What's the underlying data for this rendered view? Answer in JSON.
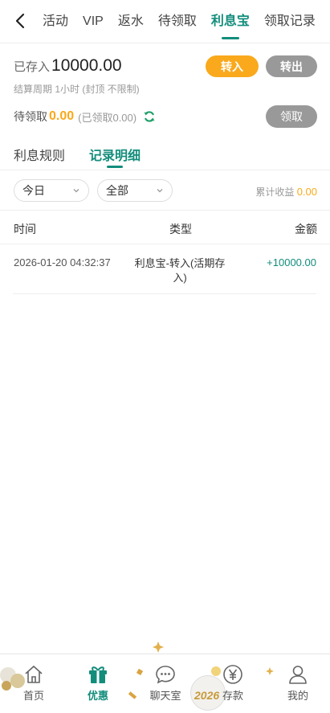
{
  "nav": {
    "tabs": [
      {
        "label": "活动"
      },
      {
        "label": "VIP"
      },
      {
        "label": "返水"
      },
      {
        "label": "待领取"
      },
      {
        "label": "利息宝"
      },
      {
        "label": "领取记录"
      }
    ],
    "active_tab": "利息宝"
  },
  "summary": {
    "deposited_label": "已存入",
    "deposited_value": "10000.00",
    "cycle_text": "结算周期 1小时 (封顶 不限制)",
    "transfer_in": "转入",
    "transfer_out": "转出",
    "pending_label": "待领取",
    "pending_amount": "0.00",
    "claimed_text": "(已领取0.00)",
    "claim_button": "领取"
  },
  "subtabs": [
    {
      "label": "利息规则"
    },
    {
      "label": "记录明细"
    }
  ],
  "filters": {
    "date": "今日",
    "type": "全部",
    "cumulative_label": "累计收益",
    "cumulative_amount": "0.00"
  },
  "table": {
    "headers": [
      "时间",
      "类型",
      "金额"
    ],
    "rows": [
      {
        "time": "2026-01-20 04:32:37",
        "type": "利息宝-转入(活期存入)",
        "amount": "+10000.00"
      }
    ]
  },
  "bottom_nav": [
    {
      "label": "首页",
      "icon": "home-icon"
    },
    {
      "label": "优惠",
      "icon": "gift-icon"
    },
    {
      "label": "聊天室",
      "icon": "chat-icon"
    },
    {
      "label": "存款",
      "icon": "yen-icon"
    },
    {
      "label": "我的",
      "icon": "user-icon"
    }
  ],
  "decoration_text": "2026",
  "colors": {
    "accent": "#138d7c",
    "orange": "#f9a91b",
    "gray_button": "#999999"
  }
}
